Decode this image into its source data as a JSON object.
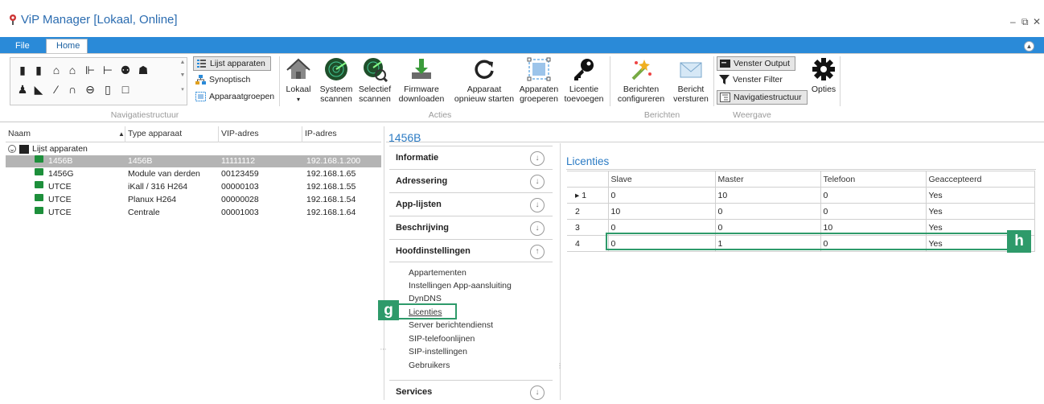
{
  "window": {
    "title": "ViP Manager [Lokaal, Online]",
    "controls": [
      "–",
      "⧉",
      "✕"
    ]
  },
  "tabs": {
    "file": "File",
    "home": "Home"
  },
  "ribbon": {
    "lijst_apparaten": "Lijst apparaten",
    "synoptisch": "Synoptisch",
    "apparaatgroepen": "Apparaatgroepen",
    "buttons": [
      {
        "line1": "Lokaal",
        "line2": "▾"
      },
      {
        "line1": "Systeem",
        "line2": "scannen"
      },
      {
        "line1": "Selectief",
        "line2": "scannen"
      },
      {
        "line1": "Firmware",
        "line2": "downloaden"
      },
      {
        "line1": "Apparaat",
        "line2": "opnieuw starten"
      },
      {
        "line1": "Apparaten",
        "line2": "groeperen"
      },
      {
        "line1": "Licentie",
        "line2": "toevoegen"
      },
      {
        "line1": "Berichten",
        "line2": "configureren"
      },
      {
        "line1": "Bericht",
        "line2": "versturen"
      }
    ],
    "venster_output": "Venster Output",
    "venster_filter": "Venster Filter",
    "navigatiestructuur": "Navigatiestructuur",
    "opties": "Opties",
    "groups": {
      "nav": "Navigatiestructuur",
      "acties": "Acties",
      "berichten": "Berichten",
      "weergave": "Weergave"
    }
  },
  "grid": {
    "columns": [
      "Naam",
      "Type apparaat",
      "VIP-adres",
      "IP-adres"
    ],
    "root": "Lijst apparaten",
    "rows": [
      {
        "name": "1456B",
        "type": "1456B",
        "vip": "11111112",
        "ip": "192.168.1.200"
      },
      {
        "name": "1456G",
        "type": "Module van derden",
        "vip": "00123459",
        "ip": "192.168.1.65"
      },
      {
        "name": "UTCE",
        "type": "iKall / 316 H264",
        "vip": "00000103",
        "ip": "192.168.1.55"
      },
      {
        "name": "UTCE",
        "type": "Planux H264",
        "vip": "00000028",
        "ip": "192.168.1.54"
      },
      {
        "name": "UTCE",
        "type": "Centrale",
        "vip": "00001003",
        "ip": "192.168.1.64"
      }
    ]
  },
  "detail": {
    "title": "1456B",
    "sections": [
      "Informatie",
      "Adressering",
      "App-lijsten",
      "Beschrijving",
      "Hoofdinstellingen",
      "Services"
    ],
    "subitems": [
      "Appartementen",
      "Instellingen App-aansluiting",
      "DynDNS",
      "Licenties",
      "Server berichtendienst",
      "SIP-telefoonlijnen",
      "SIP-instellingen",
      "Gebruikers"
    ]
  },
  "licenties": {
    "title": "Licenties",
    "columns": [
      "Slave",
      "Master",
      "Telefoon",
      "Geaccepteerd"
    ],
    "rows": [
      {
        "n": "▸ 1",
        "slave": "0",
        "master": "10",
        "tel": "0",
        "acc": "Yes"
      },
      {
        "n": "2",
        "slave": "10",
        "master": "0",
        "tel": "0",
        "acc": "Yes"
      },
      {
        "n": "3",
        "slave": "0",
        "master": "0",
        "tel": "10",
        "acc": "Yes"
      },
      {
        "n": "4",
        "slave": "0",
        "master": "1",
        "tel": "0",
        "acc": "Yes"
      }
    ]
  },
  "callouts": {
    "g": "g",
    "h": "h"
  },
  "colors": {
    "accent": "#2a8ad8",
    "callout": "#2e9a6a",
    "title": "#2b7bc4"
  }
}
